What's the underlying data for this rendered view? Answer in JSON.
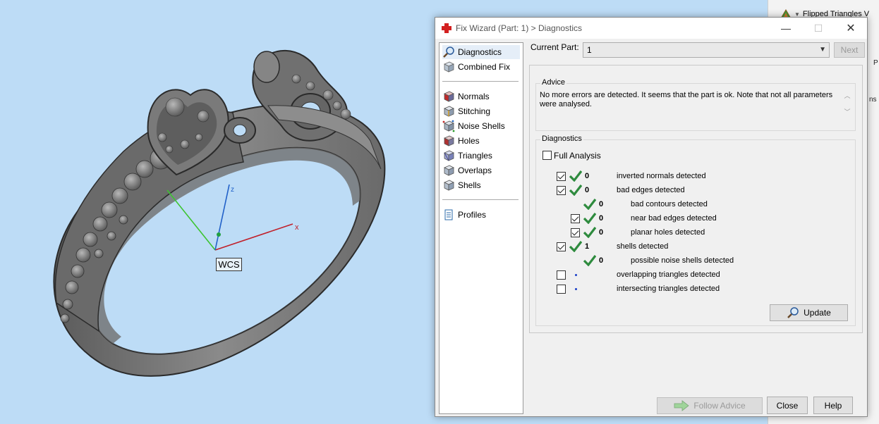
{
  "viewport": {
    "axis_x": "x",
    "axis_z": "z",
    "wcs_label": "WCS"
  },
  "side_panel": {
    "flipped_label": "Flipped Triangles V",
    "fragments": [
      "P",
      "ns"
    ]
  },
  "dialog": {
    "title": "Fix Wizard (Part: 1) > Diagnostics",
    "nav": {
      "items": [
        {
          "label": "Diagnostics",
          "icon": "magnifier-icon"
        },
        {
          "label": "Combined Fix",
          "icon": "cube-icon"
        },
        {
          "label": "Normals",
          "icon": "normals-cube-icon"
        },
        {
          "label": "Stitching",
          "icon": "stitching-cube-icon"
        },
        {
          "label": "Noise Shells",
          "icon": "noise-shells-icon"
        },
        {
          "label": "Holes",
          "icon": "holes-cube-icon"
        },
        {
          "label": "Triangles",
          "icon": "triangles-cube-icon"
        },
        {
          "label": "Overlaps",
          "icon": "overlaps-cube-icon"
        },
        {
          "label": "Shells",
          "icon": "shells-cube-icon"
        },
        {
          "label": "Profiles",
          "icon": "document-icon"
        }
      ]
    },
    "current_part_label": "Current Part:",
    "current_part_value": "1",
    "next_label": "Next",
    "advice": {
      "title": "Advice",
      "text": "No more errors are detected. It seems that the part is ok. Note that not all parameters were analysed."
    },
    "diagnostics": {
      "title": "Diagnostics",
      "full_analysis_label": "Full Analysis",
      "rows": [
        {
          "count": "0",
          "label": "inverted normals detected"
        },
        {
          "count": "0",
          "label": "bad edges detected"
        },
        {
          "count": "0",
          "label": "bad contours detected"
        },
        {
          "count": "0",
          "label": "near bad edges detected"
        },
        {
          "count": "0",
          "label": "planar holes detected"
        },
        {
          "count": "1",
          "label": "shells detected"
        },
        {
          "count": "0",
          "label": "possible noise shells detected"
        },
        {
          "count": "",
          "label": "overlapping triangles detected"
        },
        {
          "count": "",
          "label": "intersecting triangles detected"
        }
      ],
      "update_label": "Update"
    },
    "buttons": {
      "follow_advice": "Follow Advice",
      "close": "Close",
      "help": "Help"
    }
  },
  "colors": {
    "viewport_bg": "#bddcf6",
    "check_green": "#2e8b3e",
    "axis_x": "#c0202a",
    "axis_y": "#3cc430",
    "axis_z": "#2060c8"
  }
}
